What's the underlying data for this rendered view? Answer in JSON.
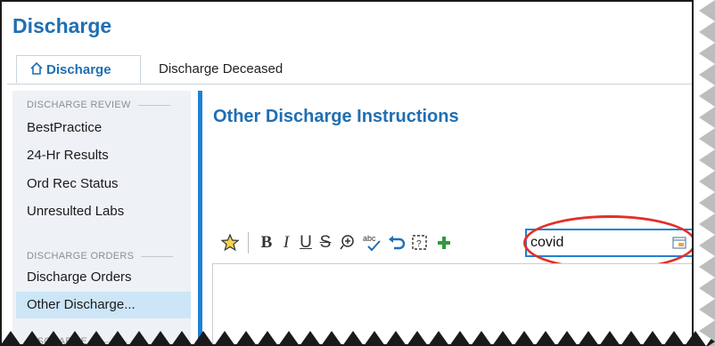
{
  "window": {
    "title": "Discharge"
  },
  "tabs": [
    {
      "label": "Discharge",
      "active": true,
      "icon": "home-icon"
    },
    {
      "label": "Discharge Deceased",
      "active": false
    }
  ],
  "sidebar": {
    "sections": [
      {
        "label": "DISCHARGE REVIEW",
        "items": [
          "BestPractice",
          "24-Hr Results",
          "Ord Rec Status",
          "Unresulted Labs"
        ]
      },
      {
        "label": "DISCHARGE ORDERS",
        "items": [
          "Discharge Orders",
          "Other Discharge..."
        ]
      },
      {
        "label": "DISCHARGE"
      }
    ],
    "selected": "Other Discharge..."
  },
  "main": {
    "heading": "Other Discharge Instructions",
    "toolbar": {
      "star_icon": "star-icon",
      "bold": "B",
      "italic": "I",
      "underline": "U",
      "strike": "S",
      "zoom_icon": "zoom-plus-icon",
      "spell_icon": "spellcheck-icon",
      "undo_icon": "undo-icon",
      "smarttext_icon": "smarttext-icon",
      "add_icon": "plus-icon"
    },
    "search": {
      "value": "covid"
    }
  },
  "colors": {
    "accent": "#1f6fb3",
    "bar": "#1f82d2",
    "selected_bg": "#cde6f7",
    "highlight": "#e2302a"
  }
}
